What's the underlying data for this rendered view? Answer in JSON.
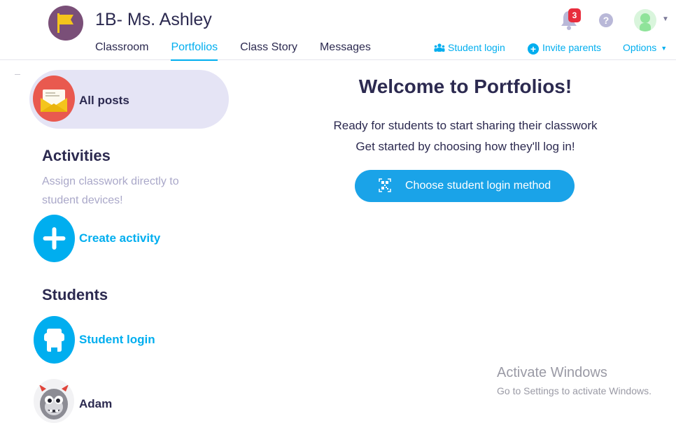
{
  "header": {
    "class_title": "1B- Ms. Ashley",
    "tabs": [
      {
        "label": "Classroom"
      },
      {
        "label": "Portfolios"
      },
      {
        "label": "Class Story"
      },
      {
        "label": "Messages"
      }
    ],
    "active_tab": "Portfolios",
    "student_login_link": "Student login",
    "invite_parents_link": "Invite parents",
    "options_link": "Options",
    "notification_count": "3",
    "help_glyph": "?",
    "accent_color": "#00aeef",
    "badge_color": "#e82c3c"
  },
  "sidebar": {
    "all_posts_label": "All posts",
    "activities": {
      "title": "Activities",
      "description": "Assign classwork directly to student devices!",
      "create_label": "Create activity"
    },
    "students": {
      "title": "Students",
      "student_login_label": "Student login",
      "list": [
        {
          "name": "Adam"
        }
      ]
    }
  },
  "main": {
    "title": "Welcome to Portfolios!",
    "line1": "Ready for students to start sharing their classwork",
    "line2": "Get started by choosing how they'll log in!",
    "button_label": "Choose student login method"
  },
  "watermark": {
    "title": "Activate Windows",
    "subtitle": "Go to Settings to activate Windows."
  }
}
